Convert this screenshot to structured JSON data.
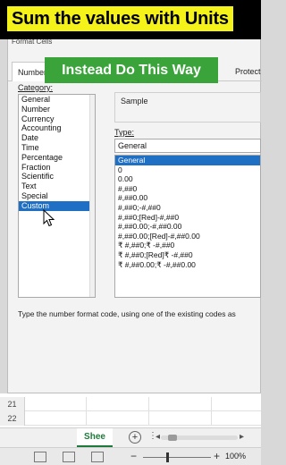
{
  "banner": {
    "text": "Sum the values with Units"
  },
  "overlay": {
    "text": "Instead Do This Way"
  },
  "dialog": {
    "title": "Format Cells",
    "tabs": [
      {
        "label": "Number"
      },
      {
        "label": "Protect"
      }
    ],
    "category_label": "Category:",
    "categories": [
      "General",
      "Number",
      "Currency",
      "Accounting",
      "Date",
      "Time",
      "Percentage",
      "Fraction",
      "Scientific",
      "Text",
      "Special",
      "Custom"
    ],
    "selected_category": "Custom",
    "sample_label": "Sample",
    "type_label": "Type:",
    "type_value": "General",
    "type_items": [
      "General",
      "0",
      "0.00",
      "#,##0",
      "#,##0.00",
      "#,##0;-#,##0",
      "#,##0;[Red]-#,##0",
      "#,##0.00;-#,##0.00",
      "#,##0.00;[Red]-#,##0.00",
      "₹ #,##0;₹ -#,##0",
      "₹ #,##0;[Red]₹ -#,##0",
      "₹ #,##0.00;₹ -#,##0.00"
    ],
    "selected_type": "General",
    "hint": "Type the number format code, using one of the existing codes as"
  },
  "sheet": {
    "rows": [
      "21",
      "22"
    ],
    "active_tab": "Shee",
    "add_label": "+",
    "more_label": "⋮"
  },
  "status": {
    "zoom_minus": "−",
    "zoom_plus": "+",
    "zoom_level": "100%"
  },
  "colors": {
    "banner_bg": "#000000",
    "banner_highlight": "#f5f21a",
    "overlay_bg": "#3aa33a",
    "selection": "#1f6fc5",
    "sheet_accent": "#1d7a3a"
  }
}
